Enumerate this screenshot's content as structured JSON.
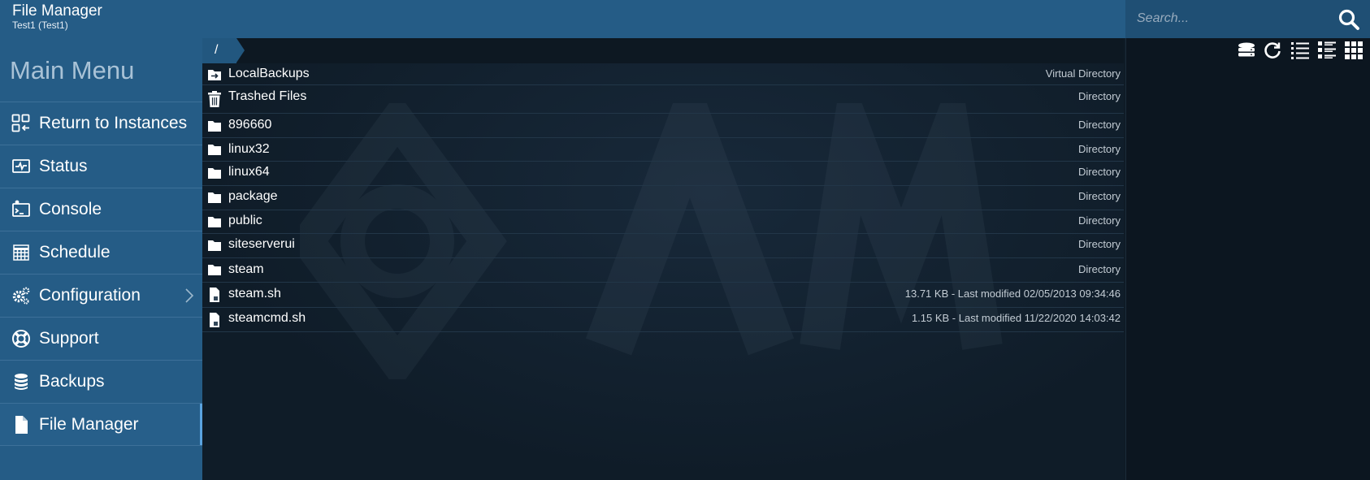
{
  "header": {
    "title": "File Manager",
    "subtitle": "Test1 (Test1)"
  },
  "search": {
    "placeholder": "Search...",
    "value": ""
  },
  "sidebar": {
    "heading": "Main Menu",
    "items": [
      {
        "label": "Return to Instances",
        "icon": "instances-icon"
      },
      {
        "label": "Status",
        "icon": "status-monitor-icon"
      },
      {
        "label": "Console",
        "icon": "console-icon"
      },
      {
        "label": "Schedule",
        "icon": "calendar-icon"
      },
      {
        "label": "Configuration",
        "icon": "gears-icon"
      },
      {
        "label": "Support",
        "icon": "lifebuoy-icon"
      },
      {
        "label": "Backups",
        "icon": "database-icon"
      },
      {
        "label": "File Manager",
        "icon": "file-icon",
        "active": true
      }
    ]
  },
  "breadcrumb": {
    "path": "/"
  },
  "files": [
    {
      "name": "LocalBackups",
      "meta": "Virtual Directory",
      "icon": "virtual-folder-icon"
    },
    {
      "name": "Trashed Files",
      "meta": "Directory",
      "icon": "trash-icon"
    },
    {
      "name": "896660",
      "meta": "Directory",
      "icon": "folder-icon"
    },
    {
      "name": "linux32",
      "meta": "Directory",
      "icon": "folder-icon"
    },
    {
      "name": "linux64",
      "meta": "Directory",
      "icon": "folder-icon"
    },
    {
      "name": "package",
      "meta": "Directory",
      "icon": "folder-icon"
    },
    {
      "name": "public",
      "meta": "Directory",
      "icon": "folder-icon"
    },
    {
      "name": "siteserverui",
      "meta": "Directory",
      "icon": "folder-icon"
    },
    {
      "name": "steam",
      "meta": "Directory",
      "icon": "folder-icon"
    },
    {
      "name": "steam.sh",
      "meta": "13.71 KB - Last modified 02/05/2013 09:34:46",
      "icon": "file-icon"
    },
    {
      "name": "steamcmd.sh",
      "meta": "1.15 KB - Last modified 11/22/2020 14:03:42",
      "icon": "file-icon"
    }
  ],
  "toolbar": {
    "buttons": [
      "storage-icon",
      "refresh-icon",
      "list-view-icon",
      "detail-list-icon",
      "grid-view-icon"
    ]
  },
  "colors": {
    "header": "#255c86",
    "sidebar": "#255c86",
    "main_bg": "#0f1c28",
    "accent": "#5aa3e0"
  }
}
